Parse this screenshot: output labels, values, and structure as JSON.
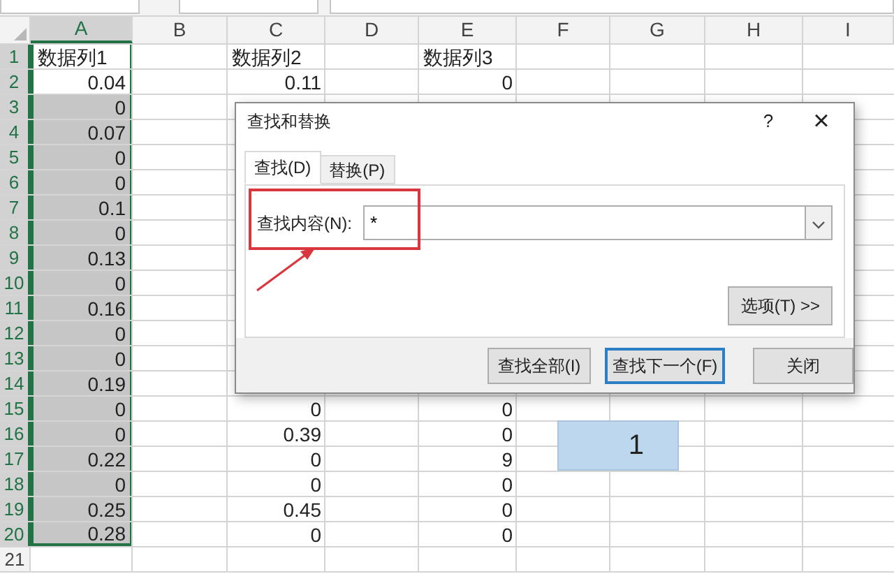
{
  "columns": [
    {
      "label": "A",
      "selected": true
    },
    {
      "label": "B",
      "selected": false
    },
    {
      "label": "C",
      "selected": false
    },
    {
      "label": "D",
      "selected": false
    },
    {
      "label": "E",
      "selected": false
    },
    {
      "label": "F",
      "selected": false
    },
    {
      "label": "G",
      "selected": false
    },
    {
      "label": "H",
      "selected": false
    },
    {
      "label": "I",
      "selected": false
    }
  ],
  "rows": [
    {
      "number": "1",
      "selected": true,
      "shaded": false,
      "cells": [
        "数据列1",
        "",
        "数据列2",
        "",
        "数据列3",
        "",
        "",
        "",
        ""
      ]
    },
    {
      "number": "2",
      "selected": true,
      "shaded": false,
      "cells": [
        "0.04",
        "",
        "0.11",
        "",
        "0",
        "",
        "",
        "",
        ""
      ]
    },
    {
      "number": "3",
      "selected": true,
      "shaded": true,
      "cells": [
        "0",
        "",
        "",
        "",
        "",
        "",
        "",
        "",
        ""
      ]
    },
    {
      "number": "4",
      "selected": true,
      "shaded": true,
      "cells": [
        "0.07",
        "",
        "",
        "",
        "",
        "",
        "",
        "",
        ""
      ]
    },
    {
      "number": "5",
      "selected": true,
      "shaded": true,
      "cells": [
        "0",
        "",
        "",
        "",
        "",
        "",
        "",
        "",
        ""
      ]
    },
    {
      "number": "6",
      "selected": true,
      "shaded": true,
      "cells": [
        "0",
        "",
        "",
        "",
        "",
        "",
        "",
        "",
        ""
      ]
    },
    {
      "number": "7",
      "selected": true,
      "shaded": true,
      "cells": [
        "0.1",
        "",
        "",
        "",
        "",
        "",
        "",
        "",
        ""
      ]
    },
    {
      "number": "8",
      "selected": true,
      "shaded": true,
      "cells": [
        "0",
        "",
        "",
        "",
        "",
        "",
        "",
        "",
        ""
      ]
    },
    {
      "number": "9",
      "selected": true,
      "shaded": true,
      "cells": [
        "0.13",
        "",
        "",
        "",
        "",
        "",
        "",
        "",
        ""
      ]
    },
    {
      "number": "10",
      "selected": true,
      "shaded": true,
      "cells": [
        "0",
        "",
        "",
        "",
        "",
        "",
        "",
        "",
        ""
      ]
    },
    {
      "number": "11",
      "selected": true,
      "shaded": true,
      "cells": [
        "0.16",
        "",
        "",
        "",
        "",
        "",
        "",
        "",
        ""
      ]
    },
    {
      "number": "12",
      "selected": true,
      "shaded": true,
      "cells": [
        "0",
        "",
        "",
        "",
        "",
        "",
        "",
        "",
        ""
      ]
    },
    {
      "number": "13",
      "selected": true,
      "shaded": true,
      "cells": [
        "0",
        "",
        "",
        "",
        "",
        "",
        "",
        "",
        ""
      ]
    },
    {
      "number": "14",
      "selected": true,
      "shaded": true,
      "cells": [
        "0.19",
        "",
        "",
        "",
        "",
        "",
        "",
        "",
        ""
      ]
    },
    {
      "number": "15",
      "selected": true,
      "shaded": true,
      "cells": [
        "0",
        "",
        "0",
        "",
        "0",
        "",
        "",
        "",
        ""
      ]
    },
    {
      "number": "16",
      "selected": true,
      "shaded": true,
      "cells": [
        "0",
        "",
        "0.39",
        "",
        "0",
        "",
        "",
        "",
        ""
      ]
    },
    {
      "number": "17",
      "selected": true,
      "shaded": true,
      "cells": [
        "0.22",
        "",
        "0",
        "",
        "9",
        "",
        "",
        "",
        ""
      ]
    },
    {
      "number": "18",
      "selected": true,
      "shaded": true,
      "cells": [
        "0",
        "",
        "0",
        "",
        "0",
        "",
        "",
        "",
        ""
      ]
    },
    {
      "number": "19",
      "selected": true,
      "shaded": true,
      "cells": [
        "0.25",
        "",
        "0.45",
        "",
        "0",
        "",
        "",
        "",
        ""
      ]
    },
    {
      "number": "20",
      "selected": true,
      "shaded": true,
      "cells": [
        "0.28",
        "",
        "0",
        "",
        "0",
        "",
        "",
        "",
        ""
      ]
    },
    {
      "number": "21",
      "selected": false,
      "shaded": false,
      "cells": [
        "",
        "",
        "",
        "",
        "",
        "",
        "",
        "",
        ""
      ]
    }
  ],
  "merged_cell": {
    "text": "1"
  },
  "dialog": {
    "title": "查找和替换",
    "help": "?",
    "close": "×",
    "tabs": [
      {
        "label": "查找(D)",
        "selected": true
      },
      {
        "label": "替换(P)",
        "selected": false
      }
    ],
    "find_label": "查找内容(N):",
    "find_value": "*",
    "options_button": "选项(T) >>",
    "buttons": [
      {
        "label": "查找全部(I)",
        "focused": false
      },
      {
        "label": "查找下一个(F)",
        "focused": true
      },
      {
        "label": "关闭",
        "focused": false
      }
    ]
  }
}
